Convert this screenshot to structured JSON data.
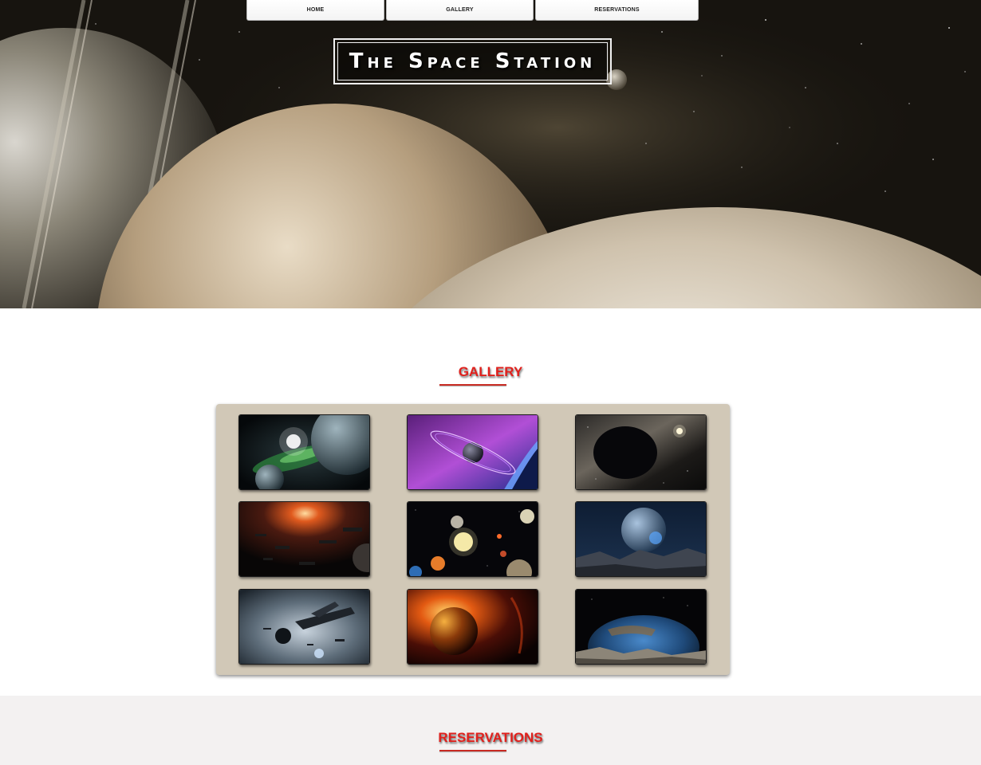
{
  "nav": {
    "home": "HOME",
    "gallery": "GALLERY",
    "reservations": "RESERVATIONS"
  },
  "hero": {
    "title": "The Space Station"
  },
  "gallery": {
    "heading": "GALLERY",
    "thumbnails": [
      {
        "subject": "green nebula planet"
      },
      {
        "subject": "purple ringed planet"
      },
      {
        "subject": "dark planet eclipse"
      },
      {
        "subject": "space battle explosion"
      },
      {
        "subject": "solar system planets"
      },
      {
        "subject": "blue planet over moonscape"
      },
      {
        "subject": "spaceship fleet"
      },
      {
        "subject": "burning planet"
      },
      {
        "subject": "earthrise over moon"
      }
    ]
  },
  "reservations": {
    "heading": "RESERVATIONS"
  },
  "colors": {
    "accent_red": "#e0201c",
    "gallery_panel": "#d1c8b7",
    "reservations_bg": "#f3f1f1"
  }
}
